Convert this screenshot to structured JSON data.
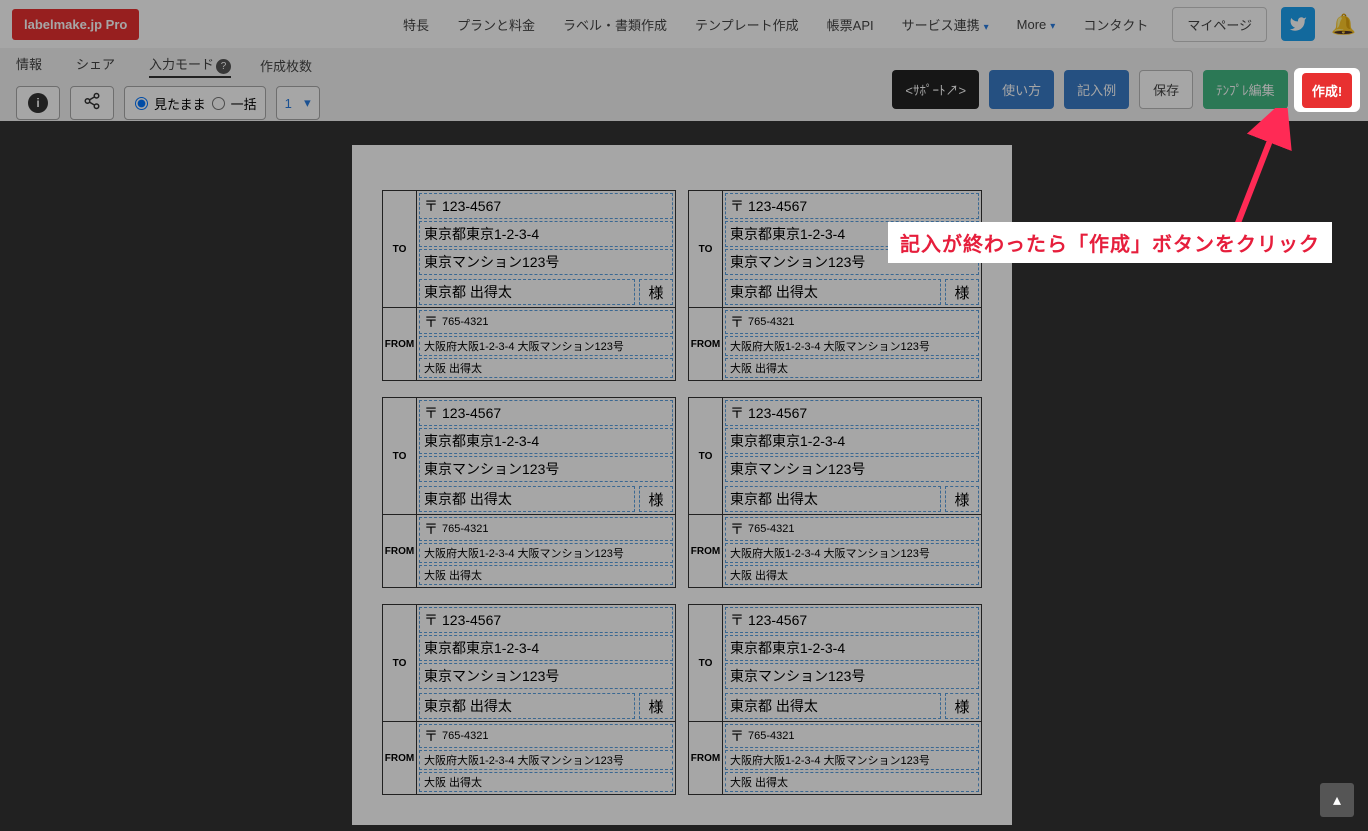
{
  "logo": "labelmake.jp Pro",
  "nav": {
    "features": "特長",
    "pricing": "プランと料金",
    "labels": "ラベル・書類作成",
    "templates": "テンプレート作成",
    "api": "帳票API",
    "services": "サービス連携",
    "more": "More",
    "contact": "コンタクト",
    "mypage": "マイページ"
  },
  "tabs": {
    "info": "情報",
    "share": "シェア",
    "input": "入力モード",
    "count": "作成枚数"
  },
  "radio": {
    "preview": "見たまま",
    "batch": "一括"
  },
  "pagecount": "1",
  "btns": {
    "support": "<ｻﾎﾟｰﾄ↗>",
    "howto": "使い方",
    "example": "記入例",
    "save": "保存",
    "edit": "ﾃﾝﾌﾟﾚ編集",
    "create": "作成!"
  },
  "callout": "記入が終わったら「作成」ボタンをクリック",
  "label": {
    "to": "TO",
    "from": "FROM",
    "sama": "様",
    "post": "〒",
    "to_postal": "123-4567",
    "to_addr1": "東京都東京1-2-3-4",
    "to_addr2": "東京マンション123号",
    "to_name": "東京都 出得太",
    "from_postal": "765-4321",
    "from_addr": "大阪府大阪1-2-3-4 大阪マンション123号",
    "from_name": "大阪 出得太"
  }
}
